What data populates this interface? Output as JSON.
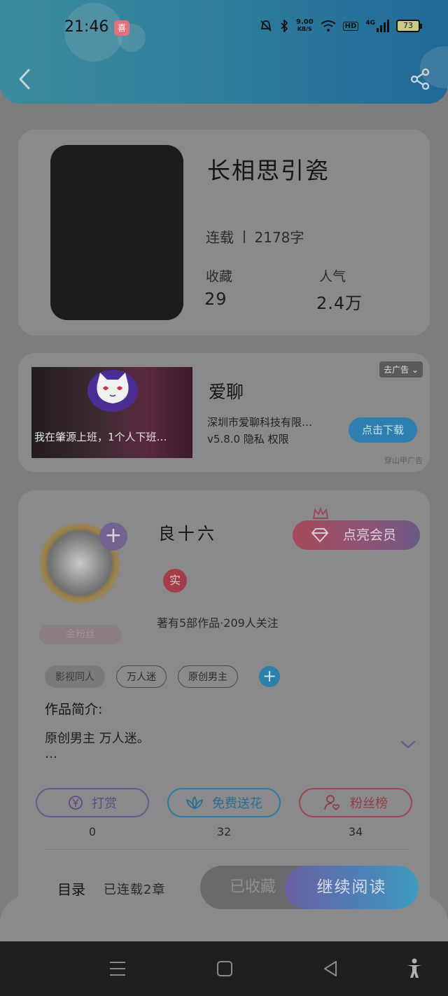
{
  "status_bar": {
    "time": "21:46",
    "app_badge": "喜",
    "net_speed": "9.00",
    "net_unit": "KB/S",
    "hd": "HD",
    "signal": "4G",
    "battery": "73"
  },
  "book": {
    "title": "长相思引瓷",
    "status": "连载",
    "word_count": "2178字",
    "favorites_label": "收藏",
    "favorites_value": "29",
    "popularity_label": "人气",
    "popularity_value": "2.4万"
  },
  "ad": {
    "caption": "我在肇源上班，1个人下班…",
    "title": "爱聊",
    "company": "深圳市爱聊科技有限…",
    "version": "v5.8.0  隐私  权限",
    "remove_label": "去广告 ⌄",
    "download_label": "点击下载",
    "source": "穿山甲广告"
  },
  "author": {
    "name": "良十六",
    "vip_label": "点亮会员",
    "verified": "实",
    "stats": "著有5部作品·209人关注",
    "fan_badge": "金粉丝",
    "tags": [
      "影视同人",
      "万人迷",
      "原创男主"
    ],
    "intro_label": "作品简介:",
    "intro_text": "原创男主 万人迷。",
    "intro_more": "…"
  },
  "actions": [
    {
      "label": "打赏",
      "count": "0"
    },
    {
      "label": "免费送花",
      "count": "32"
    },
    {
      "label": "粉丝榜",
      "count": "34"
    }
  ],
  "read_bar": {
    "toc_label": "目录",
    "progress": "已连载2章",
    "favorited_label": "已收藏",
    "continue_label": "继续阅读"
  },
  "colors": {
    "header": "#3a9fc7",
    "accent_purple": "#6a5a88",
    "accent_blue": "#2d7ba0",
    "accent_red": "#9a474f"
  }
}
